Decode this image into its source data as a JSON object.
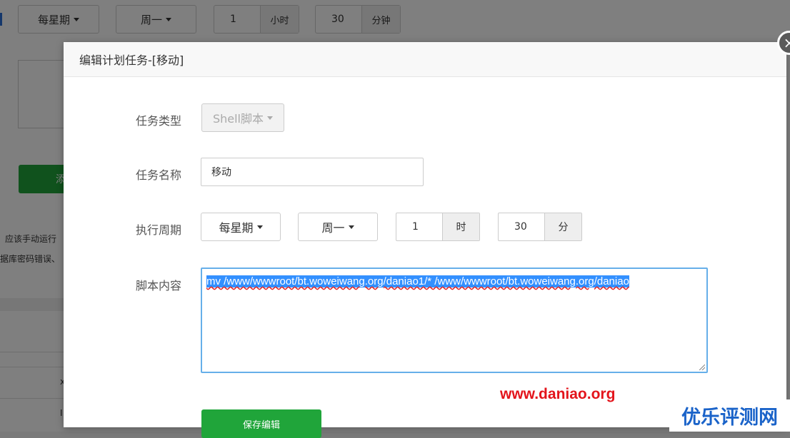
{
  "background": {
    "period": "每星期",
    "weekday": "周一",
    "hour": {
      "value": "1",
      "unit": "小时"
    },
    "minute": {
      "value": "30",
      "unit": "分钟"
    },
    "green_button_fragment": "添",
    "text_line_1": "应该手动运行",
    "text_line_2": "据库密码错误、",
    "row_fragment_1": "x",
    "row_fragment_2": "I"
  },
  "modal": {
    "title": "编辑计划任务-[移动]",
    "close_glyph": "×",
    "task_type": {
      "label": "任务类型",
      "value": "Shell脚本"
    },
    "task_name": {
      "label": "任务名称",
      "value": "移动"
    },
    "schedule": {
      "label": "执行周期",
      "period": "每星期",
      "weekday": "周一",
      "hour": {
        "value": "1",
        "unit": "时"
      },
      "minute": {
        "value": "30",
        "unit": "分"
      }
    },
    "script": {
      "label": "脚本内容",
      "value": "mv /www/wwwroot/bt.woweiwang.org/daniao1/* /www/wwwroot/bt.woweiwang.org/daniao"
    },
    "save_label": "保存编辑"
  },
  "watermarks": {
    "url": "www.daniao.org",
    "site": "优乐评测网"
  },
  "colors": {
    "accent_green": "#20a53a",
    "focus_blue": "#66afe9",
    "selection_blue": "#3390ff",
    "watermark_red": "#e3141b",
    "site_blue": "#1a63c9"
  },
  "icons": {
    "dropdown": "chevron-down-icon",
    "close": "close-icon",
    "resize": "resize-grip-icon"
  }
}
